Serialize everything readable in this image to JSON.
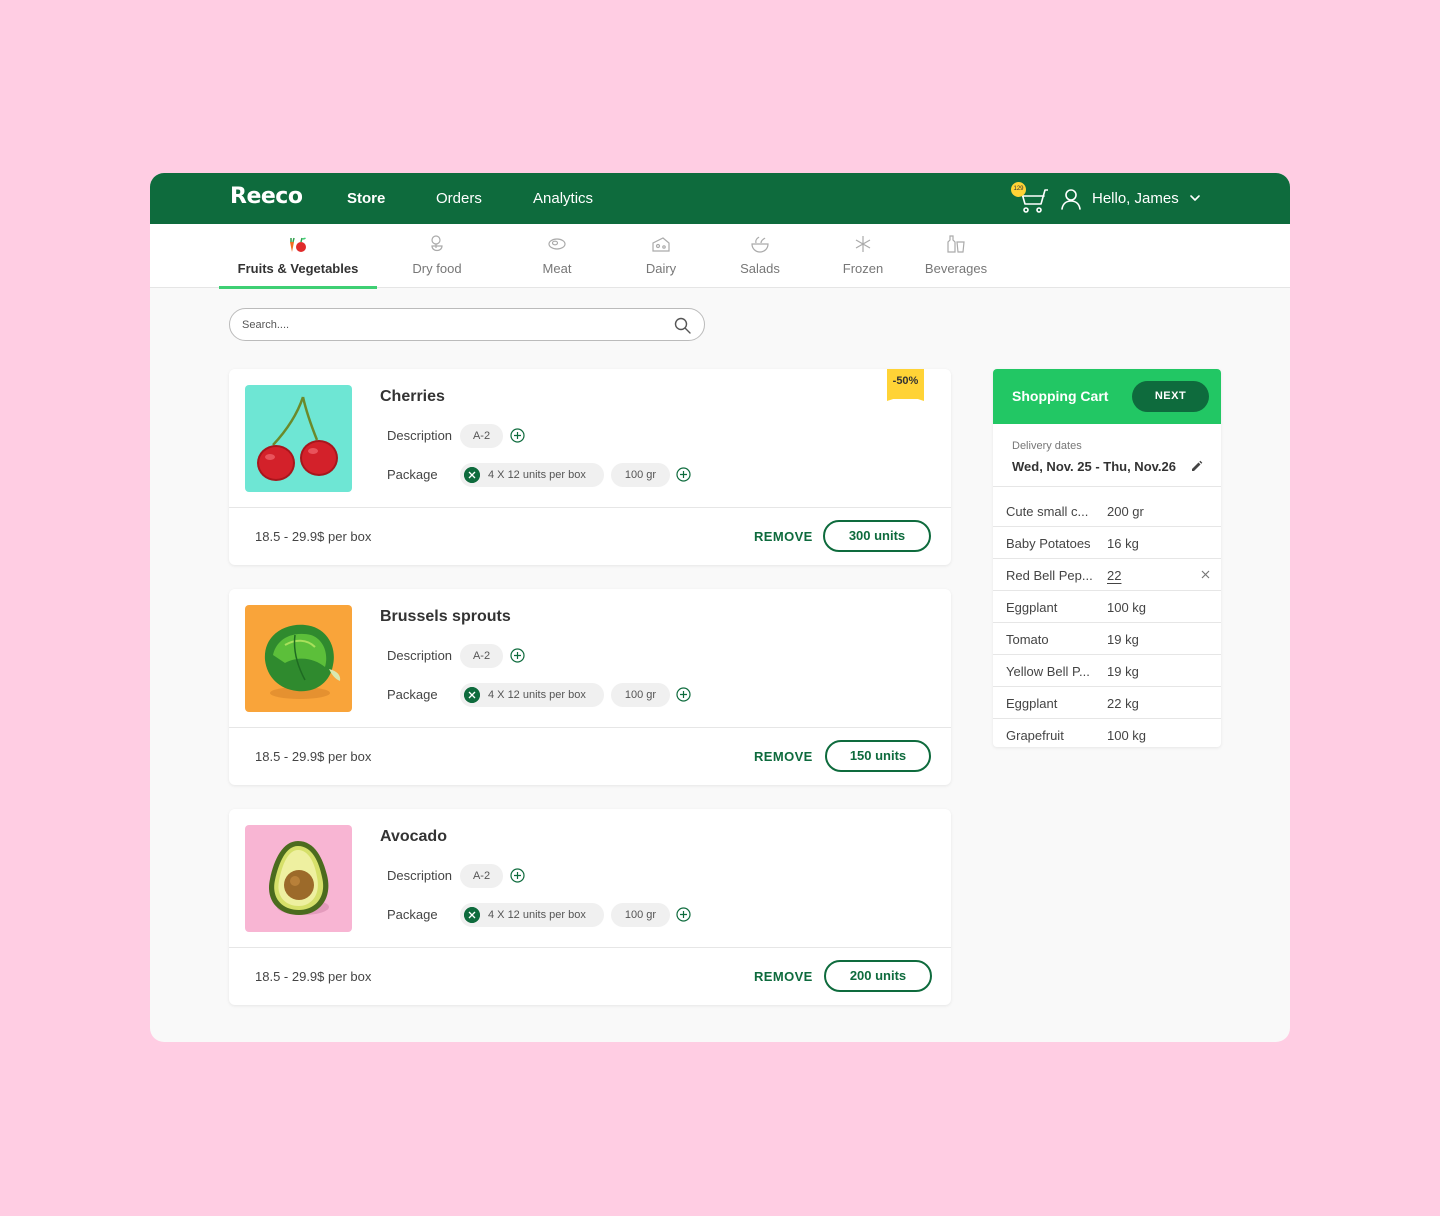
{
  "header": {
    "logo": "Reeco",
    "nav": [
      {
        "label": "Store",
        "active": true
      },
      {
        "label": "Orders",
        "active": false
      },
      {
        "label": "Analytics",
        "active": false
      }
    ],
    "cart_count": "129",
    "user_greeting": "Hello, James",
    "icons": [
      "shopping-cart-icon",
      "user-icon",
      "chevron-down-icon"
    ]
  },
  "categories": [
    {
      "label": "Fruits & Vegetables",
      "icon": "fruits-vegetables-icon",
      "active": true
    },
    {
      "label": "Dry food",
      "icon": "dry-food-icon",
      "active": false
    },
    {
      "label": "Meat",
      "icon": "meat-icon",
      "active": false
    },
    {
      "label": "Dairy",
      "icon": "dairy-icon",
      "active": false
    },
    {
      "label": "Salads",
      "icon": "salads-icon",
      "active": false
    },
    {
      "label": "Frozen",
      "icon": "snowflake-icon",
      "active": false
    },
    {
      "label": "Beverages",
      "icon": "beverages-icon",
      "active": false
    }
  ],
  "search": {
    "placeholder": "Search....",
    "value": ""
  },
  "products": [
    {
      "name": "Cherries",
      "discount": "-50%",
      "description_label": "Description",
      "description_value": "A-2",
      "package_label": "Package",
      "package_units": "4 X 12 units per box",
      "package_weight": "100 gr",
      "price": "18.5 - 29.9$ per box",
      "remove_label": "REMOVE",
      "quantity": "300 units",
      "image_bg": "#6ee6d4"
    },
    {
      "name": "Brussels sprouts",
      "discount": "",
      "description_label": "Description",
      "description_value": "A-2",
      "package_label": "Package",
      "package_units": "4 X 12 units per box",
      "package_weight": "100 gr",
      "price": "18.5 - 29.9$ per box",
      "remove_label": "REMOVE",
      "quantity": "150 units",
      "image_bg": "#f9a43a"
    },
    {
      "name": "Avocado",
      "discount": "",
      "description_label": "Description",
      "description_value": "A-2",
      "package_label": "Package",
      "package_units": "4 X 12 units per box",
      "package_weight": "100 gr",
      "price": "18.5 - 29.9$ per box",
      "remove_label": "REMOVE",
      "quantity": "200 units",
      "image_bg": "#f8b5d3"
    }
  ],
  "cart": {
    "title": "Shopping Cart",
    "next_label": "NEXT",
    "delivery_label": "Delivery dates",
    "delivery_value": "Wed, Nov. 25 - Thu, Nov.26",
    "items": [
      {
        "name": "Cute small c...",
        "qty": "200 gr",
        "editing": false
      },
      {
        "name": "Baby Potatoes",
        "qty": "16 kg",
        "editing": false
      },
      {
        "name": "Red Bell Pep...",
        "qty": "22",
        "editing": true
      },
      {
        "name": "Eggplant",
        "qty": "100 kg",
        "editing": false
      },
      {
        "name": "Tomato",
        "qty": "19 kg",
        "editing": false
      },
      {
        "name": "Yellow Bell P...",
        "qty": "19 kg",
        "editing": false
      },
      {
        "name": "Eggplant",
        "qty": "22 kg",
        "editing": false
      },
      {
        "name": "Grapefruit",
        "qty": "100 kg",
        "editing": false
      }
    ]
  },
  "colors": {
    "brand_dark_green": "#0e6b3d",
    "accent_green": "#22c764",
    "tab_underline": "#3ecf73",
    "discount_yellow": "#ffd336",
    "page_background": "#ffcde3"
  }
}
